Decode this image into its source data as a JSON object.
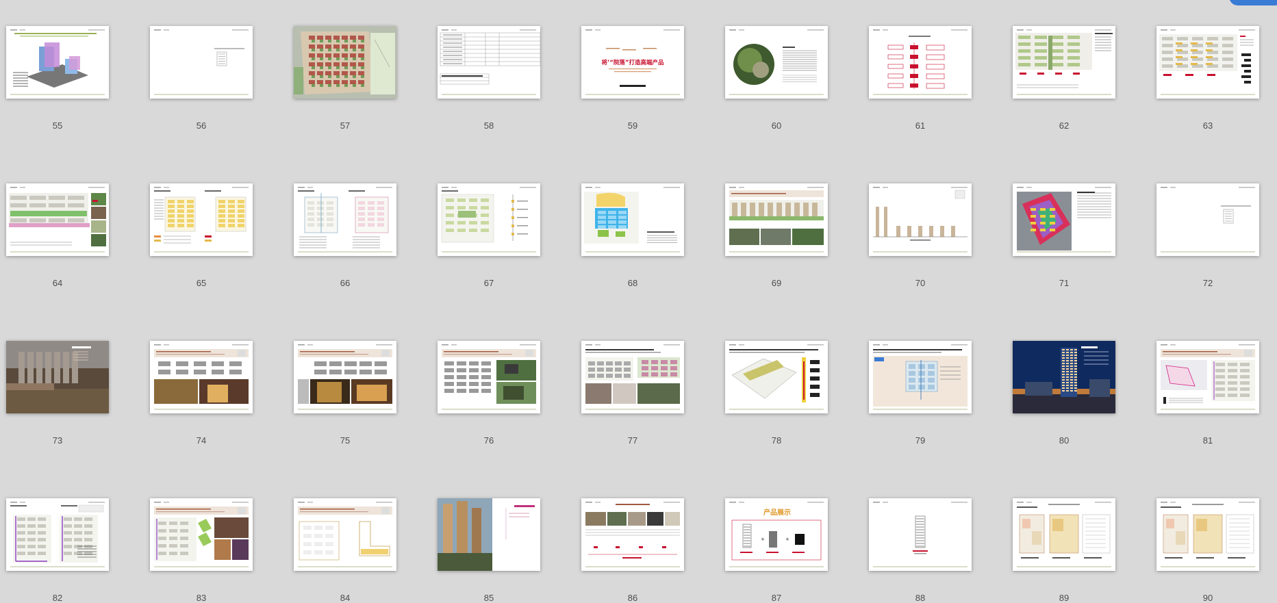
{
  "thumbnails": [
    {
      "page": "55",
      "title": "",
      "kind": "massing"
    },
    {
      "page": "56",
      "title": "",
      "kind": "blank-center"
    },
    {
      "page": "57",
      "title": "",
      "kind": "siteplan"
    },
    {
      "page": "58",
      "title": "",
      "kind": "table"
    },
    {
      "page": "59",
      "title": "将’“院落”打造高端产品",
      "kind": "slogan"
    },
    {
      "page": "60",
      "title": "",
      "kind": "circle-photo"
    },
    {
      "page": "61",
      "title": "",
      "kind": "flowchart"
    },
    {
      "page": "62",
      "title": "",
      "kind": "plan-strips"
    },
    {
      "page": "63",
      "title": "",
      "kind": "plan-legend"
    },
    {
      "page": "64",
      "title": "",
      "kind": "plan-photos"
    },
    {
      "page": "65",
      "title": "",
      "kind": "two-plans-yellow"
    },
    {
      "page": "66",
      "title": "",
      "kind": "two-plans-outline"
    },
    {
      "page": "67",
      "title": "",
      "kind": "plan-green"
    },
    {
      "page": "68",
      "title": "",
      "kind": "blue-zones"
    },
    {
      "page": "69",
      "title": "",
      "kind": "elevation-photos"
    },
    {
      "page": "70",
      "title": "",
      "kind": "skyline"
    },
    {
      "page": "71",
      "title": "",
      "kind": "heatmap"
    },
    {
      "page": "72",
      "title": "",
      "kind": "blank-center"
    },
    {
      "page": "73",
      "title": "",
      "kind": "aerial"
    },
    {
      "page": "74",
      "title": "",
      "kind": "diagram-photos"
    },
    {
      "page": "75",
      "title": "",
      "kind": "diagram-lobby"
    },
    {
      "page": "76",
      "title": "",
      "kind": "diagram-gardens"
    },
    {
      "page": "77",
      "title": "",
      "kind": "section-collage"
    },
    {
      "page": "78",
      "title": "",
      "kind": "perspective-plan"
    },
    {
      "page": "79",
      "title": "",
      "kind": "unit-plan"
    },
    {
      "page": "80",
      "title": "",
      "kind": "tower-night"
    },
    {
      "page": "81",
      "title": "",
      "kind": "circulation"
    },
    {
      "page": "82",
      "title": "",
      "kind": "two-plans-purple"
    },
    {
      "page": "83",
      "title": "",
      "kind": "plan-shops"
    },
    {
      "page": "84",
      "title": "",
      "kind": "plan-outline-l"
    },
    {
      "page": "85",
      "title": "",
      "kind": "tower-photo"
    },
    {
      "page": "86",
      "title": "",
      "kind": "photo-row"
    },
    {
      "page": "87",
      "title": "产品展示",
      "kind": "product"
    },
    {
      "page": "88",
      "title": "",
      "kind": "single-tower"
    },
    {
      "page": "89",
      "title": "",
      "kind": "floorplans"
    },
    {
      "page": "90",
      "title": "",
      "kind": "floorplans"
    }
  ],
  "colors": {
    "background": "#d9d9d9",
    "label": "#4d4d4d",
    "accent_red": "#c8102e",
    "corner_button": "#3a7bd5"
  }
}
